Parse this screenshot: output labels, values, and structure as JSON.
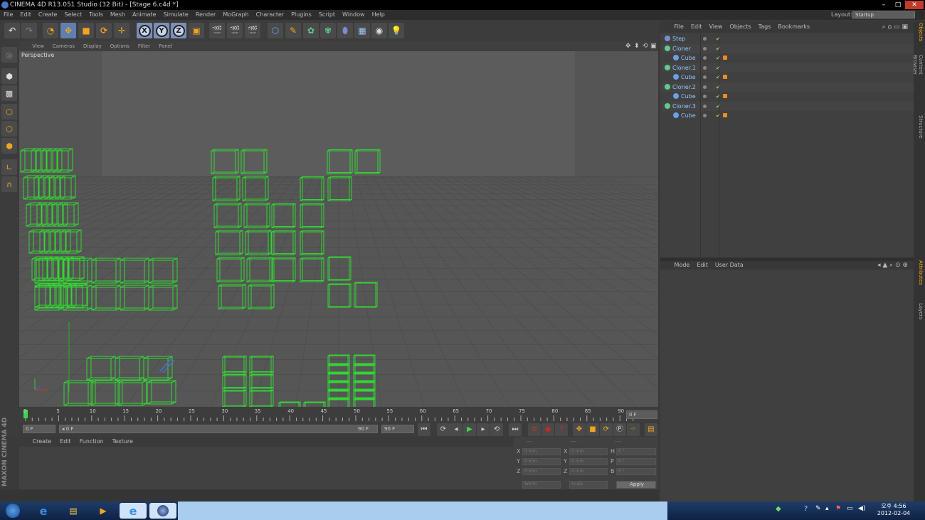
{
  "window": {
    "title": "CINEMA 4D R13.051 Studio (32 Bit) - [Stage 6.c4d *]",
    "controls": [
      "–",
      "□",
      "✕"
    ]
  },
  "menu": {
    "items": [
      "File",
      "Edit",
      "Create",
      "Select",
      "Tools",
      "Mesh",
      "Animate",
      "Simulate",
      "Render",
      "MoGraph",
      "Character",
      "Plugins",
      "Script",
      "Window",
      "Help"
    ],
    "layout_label": "Layout:",
    "layout_value": "Startup"
  },
  "toolbar": {
    "axis_x": "X",
    "axis_y": "Y",
    "axis_z": "Z"
  },
  "viewport": {
    "menu": [
      "View",
      "Cameras",
      "Display",
      "Options",
      "Filter",
      "Panel"
    ],
    "label": "Perspective"
  },
  "timeline": {
    "ticks": [
      "0",
      "5",
      "10",
      "15",
      "20",
      "25",
      "30",
      "35",
      "40",
      "45",
      "50",
      "55",
      "60",
      "65",
      "70",
      "75",
      "80",
      "85",
      "90"
    ],
    "current_frame": "0 F"
  },
  "transport": {
    "start": "0 F",
    "range_start": "0 F",
    "range_end": "90 F",
    "end": "90 F"
  },
  "material_manager": {
    "menu": [
      "Create",
      "Edit",
      "Function",
      "Texture"
    ],
    "brand": "MAXON CINEMA 4D"
  },
  "coordinates": {
    "header": [
      "---",
      "---",
      "---"
    ],
    "rows": [
      {
        "axis": "X",
        "pos": "0 mm",
        "axis2": "X",
        "size": "0 mm",
        "axis3": "H",
        "rot": "0 °"
      },
      {
        "axis": "Y",
        "pos": "0 mm",
        "axis2": "Y",
        "size": "0 mm",
        "axis3": "P",
        "rot": "0 °"
      },
      {
        "axis": "Z",
        "pos": "0 mm",
        "axis2": "Z",
        "size": "0 mm",
        "axis3": "B",
        "rot": "0 °"
      }
    ],
    "mode1": "World",
    "mode2": "Scale",
    "apply": "Apply"
  },
  "object_manager": {
    "menu": [
      "File",
      "Edit",
      "View",
      "Objects",
      "Tags",
      "Bookmarks"
    ],
    "objects": [
      {
        "name": "Step",
        "indent": 0,
        "icon": "#7a8ccf",
        "tag": false
      },
      {
        "name": "Cloner",
        "indent": 0,
        "icon": "#5ecb8f",
        "tag": false
      },
      {
        "name": "Cube",
        "indent": 1,
        "icon": "#6aa0e6",
        "tag": true
      },
      {
        "name": "Cloner.1",
        "indent": 0,
        "icon": "#5ecb8f",
        "tag": false
      },
      {
        "name": "Cube",
        "indent": 1,
        "icon": "#6aa0e6",
        "tag": true
      },
      {
        "name": "Cloner.2",
        "indent": 0,
        "icon": "#5ecb8f",
        "tag": false
      },
      {
        "name": "Cube",
        "indent": 1,
        "icon": "#6aa0e6",
        "tag": true
      },
      {
        "name": "Cloner.3",
        "indent": 0,
        "icon": "#5ecb8f",
        "tag": false
      },
      {
        "name": "Cube",
        "indent": 1,
        "icon": "#6aa0e6",
        "tag": true
      }
    ]
  },
  "attribute_manager": {
    "menu": [
      "Mode",
      "Edit",
      "User Data"
    ]
  },
  "side_tabs": {
    "top": [
      "Objects",
      "Content Browser",
      "Structure"
    ],
    "bottom": [
      "Attributes",
      "Layers"
    ]
  },
  "taskbar": {
    "time": "오후 4:56",
    "date": "2012-02-04"
  },
  "colors": {
    "accent": "#f1a51c",
    "wire": "#33d633",
    "selection": "#5f7fb0"
  }
}
